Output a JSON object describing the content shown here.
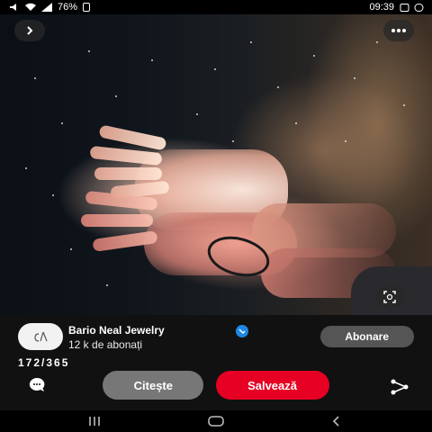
{
  "status_bar": {
    "time": "09:39",
    "battery": "76%"
  },
  "pin": {
    "creator_name": "Bario Neal Jewelry",
    "subscribers": "12 k de abonați",
    "subscribe_label": "Abonare",
    "counter": "172/365",
    "read_label": "Citește",
    "save_label": "Salvează"
  },
  "colors": {
    "accent": "#e60023",
    "verified": "#1e88e5"
  },
  "icons": [
    "back-icon",
    "more-icon",
    "visual-search-icon",
    "share-icon",
    "comment-icon",
    "verified-icon",
    "recents-icon",
    "home-icon",
    "nav-back-icon"
  ]
}
